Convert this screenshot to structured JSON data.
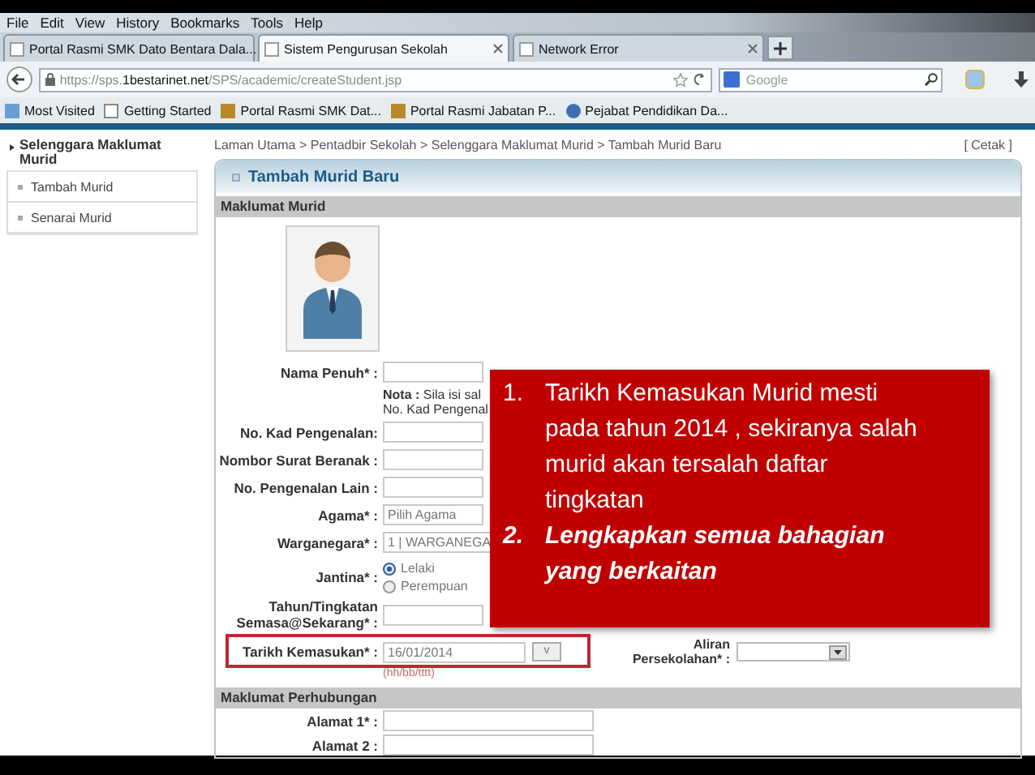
{
  "menu": [
    "File",
    "Edit",
    "View",
    "History",
    "Bookmarks",
    "Tools",
    "Help"
  ],
  "tabs": [
    {
      "title": "Portal Rasmi SMK Dato Bentara Dala...",
      "selected": false
    },
    {
      "title": "Sistem Pengurusan Sekolah",
      "selected": true
    },
    {
      "title": "Network Error",
      "selected": false
    }
  ],
  "url": {
    "before": "https://sps.",
    "domain": "1bestarinet.net",
    "after": "/SPS/academic/createStudent.jsp"
  },
  "search": {
    "placeholder": "Google"
  },
  "bookmarks": [
    "Most Visited",
    "Getting Started",
    "Portal Rasmi SMK Dat...",
    "Portal Rasmi Jabatan P...",
    "Pejabat Pendidikan Da..."
  ],
  "sidebar": {
    "heading": "Selenggara Maklumat Murid",
    "items": [
      "Tambah Murid",
      "Senarai Murid"
    ]
  },
  "breadcrumb": "Laman Utama > Pentadbir Sekolah > Selenggara Maklumat Murid > Tambah Murid Baru",
  "print_link": "[ Cetak ]",
  "panel_title": "Tambah Murid Baru",
  "section_student": "Maklumat Murid",
  "rows": [
    {
      "kind": "text",
      "label": "Nama Penuh* :"
    },
    {
      "kind": "note",
      "label_bold": "Nota :",
      "lines": [
        "Sila isi sal",
        "No. Kad Pengenal"
      ]
    },
    {
      "kind": "text",
      "label": "No. Kad Pengenalan:"
    },
    {
      "kind": "text",
      "label": "Nombor Surat Beranak :"
    },
    {
      "kind": "text",
      "label": "No. Pengenalan Lain :"
    },
    {
      "kind": "select",
      "label": "Agama* :",
      "value": "Pilih Agama"
    },
    {
      "kind": "select",
      "label": "Warganegara* :",
      "value": "1 | WARGANEGA"
    },
    {
      "kind": "radio",
      "label": "Jantina* :",
      "options": [
        {
          "label": "Lelaki",
          "selected": true
        },
        {
          "label": "Perempuan",
          "selected": false
        }
      ]
    },
    {
      "kind": "text",
      "label": "Tahun/Tingkatan Semasa@Sekarang* :"
    },
    {
      "kind": "date",
      "label": "Tarikh Kemasukan* :",
      "value": "16/01/2014",
      "button": "v",
      "hint": "(hh/bb/tttt)",
      "highlight": true,
      "side_label": "Aliran Persekolahan* :"
    }
  ],
  "section_contact": "Maklumat Perhubungan",
  "contact_rows": [
    "Alamat 1* :",
    "Alamat 2 :"
  ],
  "callout": [
    {
      "marker": "1.",
      "text": "Tarikh Kemasukan Murid mesti pada tahun 2014 , sekiranya salah murid akan tersalah daftar tingkatan",
      "emphasis": false
    },
    {
      "marker": "2.",
      "text": "Lengkapkan semua bahagian yang berkaitan",
      "emphasis": true
    }
  ]
}
